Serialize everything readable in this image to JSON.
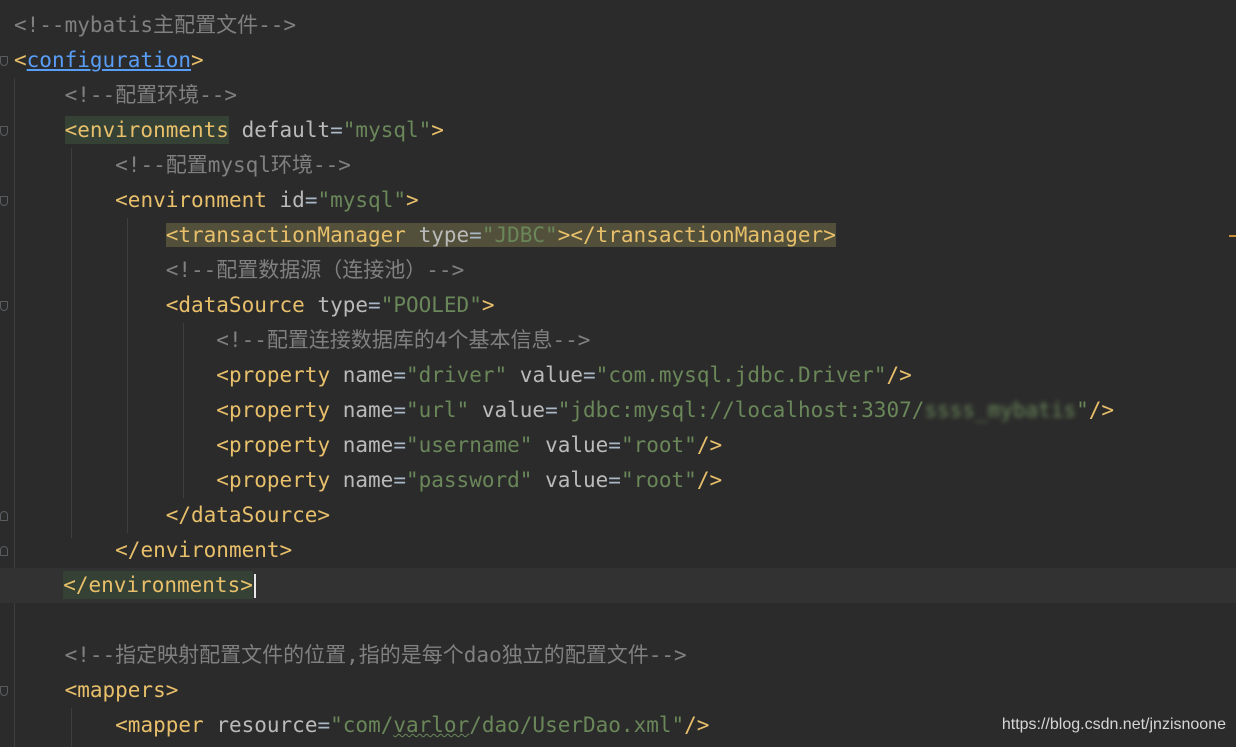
{
  "editor": {
    "lines": [
      {
        "indent": 0,
        "tokens": [
          {
            "t": "<!--mybatis主配置文件-->",
            "c": "comment"
          }
        ]
      },
      {
        "indent": 0,
        "tokens": [
          {
            "t": "<",
            "c": "tag"
          },
          {
            "t": "configuration",
            "c": "link"
          },
          {
            "t": ">",
            "c": "tag"
          }
        ]
      },
      {
        "indent": 4,
        "tokens": [
          {
            "t": "<!--配置环境-->",
            "c": "comment"
          }
        ]
      },
      {
        "indent": 4,
        "tokens": [
          {
            "t": "<environments",
            "c": "tag",
            "hl": "tag"
          },
          {
            "t": " "
          },
          {
            "t": "default",
            "c": "attr"
          },
          {
            "t": "=",
            "c": "eq"
          },
          {
            "t": "\"mysql\"",
            "c": "str"
          },
          {
            "t": ">",
            "c": "tag"
          }
        ]
      },
      {
        "indent": 8,
        "tokens": [
          {
            "t": "<!--配置mysql环境-->",
            "c": "comment"
          }
        ]
      },
      {
        "indent": 8,
        "tokens": [
          {
            "t": "<environment",
            "c": "tag"
          },
          {
            "t": " "
          },
          {
            "t": "id",
            "c": "attr"
          },
          {
            "t": "=",
            "c": "eq"
          },
          {
            "t": "\"mysql\"",
            "c": "str"
          },
          {
            "t": ">",
            "c": "tag"
          }
        ]
      },
      {
        "indent": 12,
        "tokens": [
          {
            "t": "<transactionManager",
            "c": "tag",
            "hl": "warn"
          },
          {
            "t": " ",
            "hl": "warn"
          },
          {
            "t": "type",
            "c": "attr",
            "hl": "warn"
          },
          {
            "t": "=",
            "c": "eq",
            "hl": "warn"
          },
          {
            "t": "\"JDBC\"",
            "c": "str",
            "hl": "warn"
          },
          {
            "t": "></transactionManager>",
            "c": "tag",
            "hl": "warn"
          }
        ]
      },
      {
        "indent": 12,
        "tokens": [
          {
            "t": "<!--配置数据源（连接池）-->",
            "c": "comment"
          }
        ]
      },
      {
        "indent": 12,
        "tokens": [
          {
            "t": "<dataSource",
            "c": "tag"
          },
          {
            "t": " "
          },
          {
            "t": "type",
            "c": "attr"
          },
          {
            "t": "=",
            "c": "eq"
          },
          {
            "t": "\"POOLED\"",
            "c": "str"
          },
          {
            "t": ">",
            "c": "tag"
          }
        ]
      },
      {
        "indent": 16,
        "tokens": [
          {
            "t": "<!--配置连接数据库的4个基本信息-->",
            "c": "comment"
          }
        ]
      },
      {
        "indent": 16,
        "tokens": [
          {
            "t": "<property",
            "c": "tag"
          },
          {
            "t": " "
          },
          {
            "t": "name",
            "c": "attr"
          },
          {
            "t": "=",
            "c": "eq"
          },
          {
            "t": "\"driver\"",
            "c": "str"
          },
          {
            "t": " "
          },
          {
            "t": "value",
            "c": "attr"
          },
          {
            "t": "=",
            "c": "eq"
          },
          {
            "t": "\"com.mysql.jdbc.Driver\"",
            "c": "str"
          },
          {
            "t": "/>",
            "c": "tag"
          }
        ]
      },
      {
        "indent": 16,
        "tokens": [
          {
            "t": "<property",
            "c": "tag"
          },
          {
            "t": " "
          },
          {
            "t": "name",
            "c": "attr"
          },
          {
            "t": "=",
            "c": "eq"
          },
          {
            "t": "\"url\"",
            "c": "str"
          },
          {
            "t": " "
          },
          {
            "t": "value",
            "c": "attr"
          },
          {
            "t": "=",
            "c": "eq"
          },
          {
            "t": "\"jdbc:mysql://localhost:3307/",
            "c": "str"
          },
          {
            "t": "ssss_mybatis",
            "c": "blur"
          },
          {
            "t": "\"",
            "c": "str"
          },
          {
            "t": "/>",
            "c": "tag"
          }
        ]
      },
      {
        "indent": 16,
        "tokens": [
          {
            "t": "<property",
            "c": "tag"
          },
          {
            "t": " "
          },
          {
            "t": "name",
            "c": "attr"
          },
          {
            "t": "=",
            "c": "eq"
          },
          {
            "t": "\"username\"",
            "c": "str"
          },
          {
            "t": " "
          },
          {
            "t": "value",
            "c": "attr"
          },
          {
            "t": "=",
            "c": "eq"
          },
          {
            "t": "\"root\"",
            "c": "str"
          },
          {
            "t": "/>",
            "c": "tag"
          }
        ]
      },
      {
        "indent": 16,
        "tokens": [
          {
            "t": "<property",
            "c": "tag"
          },
          {
            "t": " "
          },
          {
            "t": "name",
            "c": "attr"
          },
          {
            "t": "=",
            "c": "eq"
          },
          {
            "t": "\"password\"",
            "c": "str"
          },
          {
            "t": " "
          },
          {
            "t": "value",
            "c": "attr"
          },
          {
            "t": "=",
            "c": "eq"
          },
          {
            "t": "\"root\"",
            "c": "str"
          },
          {
            "t": "/>",
            "c": "tag"
          }
        ]
      },
      {
        "indent": 12,
        "tokens": [
          {
            "t": "</dataSource>",
            "c": "tag"
          }
        ]
      },
      {
        "indent": 8,
        "tokens": [
          {
            "t": "</environment>",
            "c": "tag"
          }
        ]
      },
      {
        "indent": 4,
        "current": true,
        "tokens": [
          {
            "t": "</environments>",
            "c": "tag",
            "hl": "tag"
          }
        ],
        "caret": true
      },
      {
        "indent": 0,
        "tokens": []
      },
      {
        "indent": 4,
        "tokens": [
          {
            "t": "<!--指定映射配置文件的位置,指的是每个dao独立的配置文件-->",
            "c": "comment"
          }
        ]
      },
      {
        "indent": 4,
        "tokens": [
          {
            "t": "<mappers>",
            "c": "tag"
          }
        ]
      },
      {
        "indent": 8,
        "tokens": [
          {
            "t": "<mapper",
            "c": "tag"
          },
          {
            "t": " "
          },
          {
            "t": "resource",
            "c": "attr"
          },
          {
            "t": "=",
            "c": "eq"
          },
          {
            "t": "\"com/",
            "c": "str"
          },
          {
            "t": "varlor",
            "c": "str",
            "typo": true
          },
          {
            "t": "/dao/UserDao.xml\"",
            "c": "str"
          },
          {
            "t": "/>",
            "c": "tag"
          }
        ]
      }
    ]
  },
  "watermark": {
    "text": "https://blog.csdn.net/jnzisnoone"
  }
}
